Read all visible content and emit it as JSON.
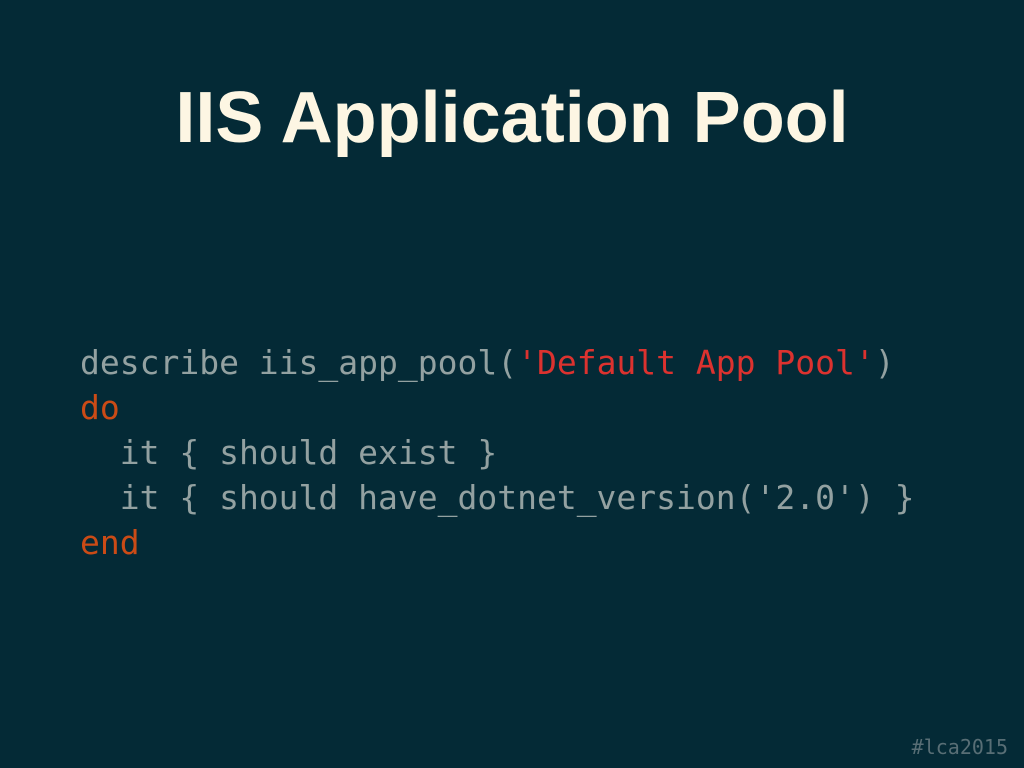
{
  "slide": {
    "title": "IIS Application Pool",
    "hashtag": "#lca2015"
  },
  "code": {
    "lines": [
      [
        {
          "text": "describe iis_app_pool(",
          "type": "plain"
        },
        {
          "text": "'Default App Pool'",
          "type": "string"
        },
        {
          "text": ")",
          "type": "plain"
        }
      ],
      [
        {
          "text": "do",
          "type": "keyword"
        }
      ],
      [
        {
          "text": "  it { should exist }",
          "type": "plain"
        }
      ],
      [
        {
          "text": "  it { should have_dotnet_version('2.0') }",
          "type": "plain"
        }
      ],
      [
        {
          "text": "end",
          "type": "keyword"
        }
      ]
    ]
  },
  "colors": {
    "background": "#042a36",
    "title": "#fdf6e3",
    "code_plain": "#93a1a1",
    "code_string": "#dc322f",
    "code_keyword": "#cb4b16",
    "hashtag": "#586e75"
  }
}
